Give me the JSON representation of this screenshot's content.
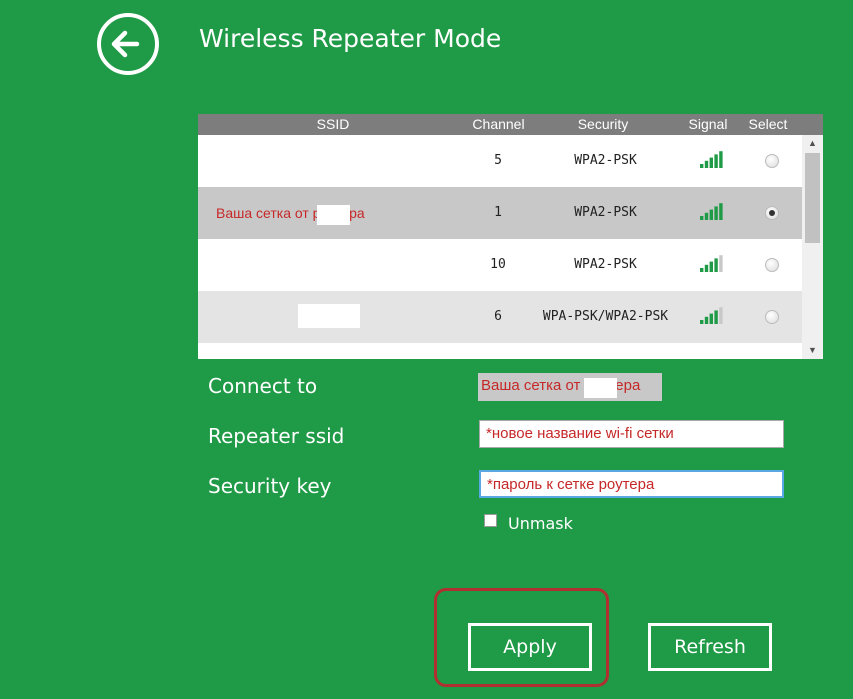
{
  "page": {
    "title": "Wireless Repeater Mode"
  },
  "table": {
    "headers": {
      "ssid": "SSID",
      "channel": "Channel",
      "security": "Security",
      "signal": "Signal",
      "select": "Select"
    },
    "rows": [
      {
        "ssid": "",
        "channel": "5",
        "security": "WPA2-PSK",
        "signal_bars": 5,
        "selected": false
      },
      {
        "ssid": "Ваша сетка от роутера",
        "channel": "1",
        "security": "WPA2-PSK",
        "signal_bars": 5,
        "selected": true
      },
      {
        "ssid": "",
        "channel": "10",
        "security": "WPA2-PSK",
        "signal_bars": 4,
        "selected": false
      },
      {
        "ssid": "",
        "channel": "6",
        "security": "WPA-PSK/WPA2-PSK",
        "signal_bars": 4,
        "selected": false
      }
    ]
  },
  "form": {
    "connect_to_label": "Connect to",
    "connect_to_value": "Ваша сетка от роутера",
    "repeater_ssid_label": "Repeater ssid",
    "repeater_ssid_value": "*новое название wi-fi сетки",
    "security_key_label": "Security key",
    "security_key_value": "*пароль к сетке роутера",
    "unmask_label": "Unmask"
  },
  "buttons": {
    "apply": "Apply",
    "refresh": "Refresh"
  },
  "colors": {
    "background": "#1f9a46",
    "signal_on": "#1f9a46",
    "signal_off": "#c8c8c8",
    "annotation": "#c62828"
  }
}
